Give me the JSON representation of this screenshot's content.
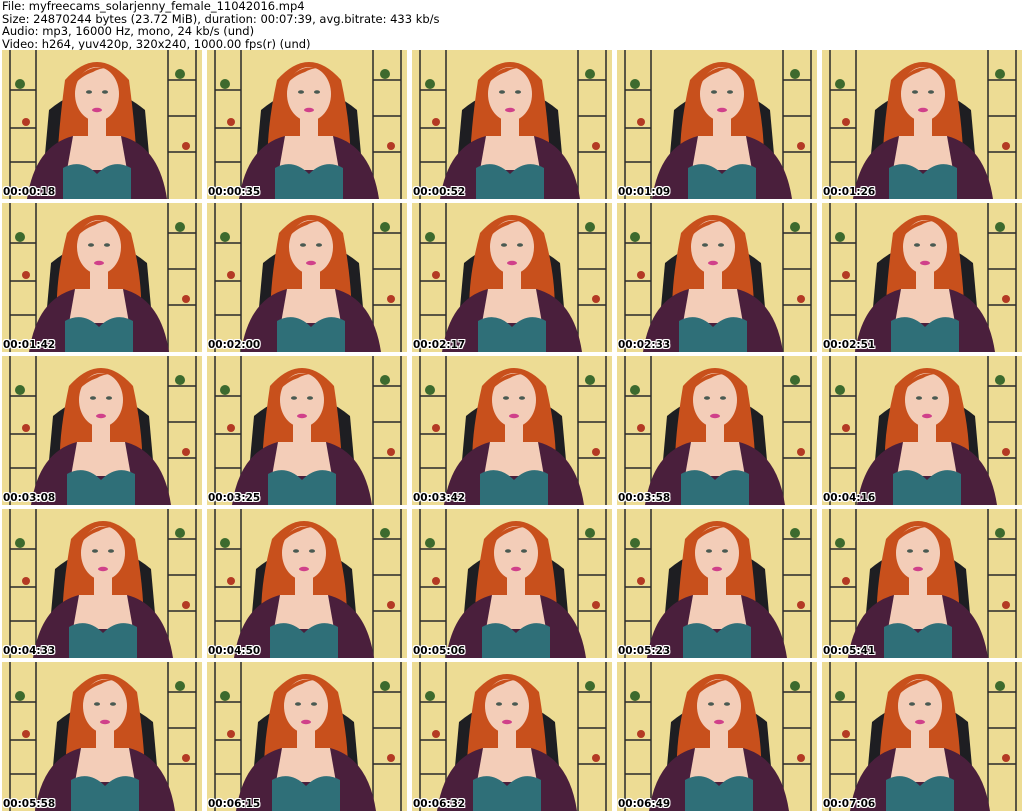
{
  "header": {
    "file_line": "File: myfreecams_solarjenny_female_11042016.mp4",
    "size_line": "Size: 24870244 bytes (23.72 MiB), duration: 00:07:39, avg.bitrate: 433 kb/s",
    "audio_line": "Audio: mp3, 16000 Hz, mono, 24 kb/s (und)",
    "video_line": "Video: h264, yuv420p, 320x240, 1000.00 fps(r) (und)"
  },
  "thumbnails": [
    {
      "timestamp": "00:00:18"
    },
    {
      "timestamp": "00:00:35"
    },
    {
      "timestamp": "00:00:52"
    },
    {
      "timestamp": "00:01:09"
    },
    {
      "timestamp": "00:01:26"
    },
    {
      "timestamp": "00:01:42"
    },
    {
      "timestamp": "00:02:00"
    },
    {
      "timestamp": "00:02:17"
    },
    {
      "timestamp": "00:02:33"
    },
    {
      "timestamp": "00:02:51"
    },
    {
      "timestamp": "00:03:08"
    },
    {
      "timestamp": "00:03:25"
    },
    {
      "timestamp": "00:03:42"
    },
    {
      "timestamp": "00:03:58"
    },
    {
      "timestamp": "00:04:16"
    },
    {
      "timestamp": "00:04:33"
    },
    {
      "timestamp": "00:04:50"
    },
    {
      "timestamp": "00:05:06"
    },
    {
      "timestamp": "00:05:23"
    },
    {
      "timestamp": "00:05:41"
    },
    {
      "timestamp": "00:05:58"
    },
    {
      "timestamp": "00:06:15"
    },
    {
      "timestamp": "00:06:32"
    },
    {
      "timestamp": "00:06:49"
    },
    {
      "timestamp": "00:07:06"
    }
  ],
  "colors": {
    "wall": "#eddc94",
    "hair": "#c8501c",
    "cardigan": "#4a1f3c",
    "bra": "#2f6f78",
    "skin": "#f3cdb8",
    "chair": "#1e1e22",
    "shelf": "#2a2a2a",
    "timestamp_text": "#000000",
    "timestamp_outline": "#ffffff"
  }
}
